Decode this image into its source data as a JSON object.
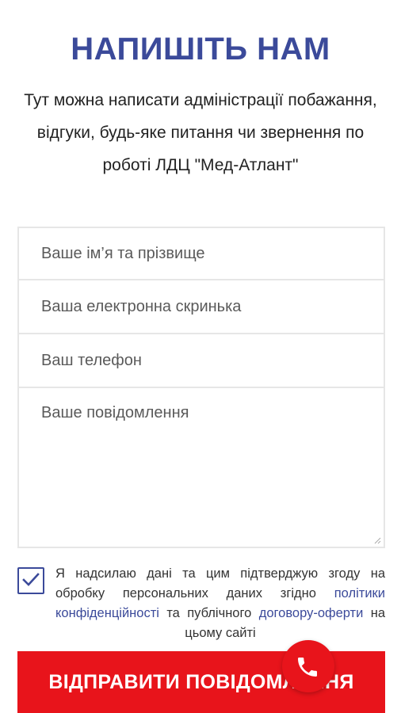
{
  "header": {
    "title": "НАПИШІТЬ НАМ",
    "intro": "Тут можна написати адміністрації побажання, відгуки, будь-яке питання чи звернення по роботі ЛДЦ \"Мед-Атлант\""
  },
  "form": {
    "name_placeholder": "Ваше ім’я та прізвище",
    "email_placeholder": "Ваша електронна скринька",
    "phone_placeholder": "Ваш телефон",
    "message_placeholder": "Ваше повідомлення"
  },
  "consent": {
    "checked": true,
    "text_before": "Я надсилаю дані та цим підтверджую згоду на обробку персональних даних згідно ",
    "privacy_link": "політики конфіденційності",
    "text_middle": " та публічного ",
    "offer_link": "договору-оферти",
    "text_after": " на цьому сайті"
  },
  "submit": {
    "label": "ВІДПРАВИТИ ПОВІДОМЛЕННЯ"
  },
  "icons": {
    "checkbox": "check-icon",
    "call": "phone-icon"
  },
  "colors": {
    "accent": "#3b4a9a",
    "button": "#e8141b"
  }
}
